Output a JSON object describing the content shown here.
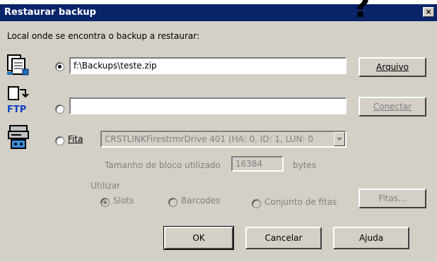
{
  "window": {
    "title": "Restaurar backup",
    "close_glyph": "×",
    "overlay_glyph": "?"
  },
  "location_label": "Local onde se encontra o backup a restaurar:",
  "sources": {
    "file": {
      "icon": "file-backup-icon",
      "selected": true,
      "value": "f:\\Backups\\teste.zip",
      "button": "Arquivo"
    },
    "ftp": {
      "icon": "ftp-icon",
      "selected": false,
      "value": "",
      "button": "Conectar"
    },
    "tape": {
      "icon": "tape-drive-icon",
      "selected": false,
      "label": "Fita",
      "drive": "CRSTLINKFirestrmrDrive  401 (HA: 0, ID: 1, LUN: 0",
      "block_label": "Tamanho de bloco utilizado",
      "block_value": "16384",
      "block_unit": "bytes",
      "use_label": "Utilizar",
      "options": {
        "slots": {
          "label": "Slots",
          "selected": true
        },
        "barcodes": {
          "label": "Barcodes",
          "selected": false
        },
        "set": {
          "label": "Conjunto de fitas",
          "selected": false
        }
      },
      "tapes_button": "Fitas..."
    }
  },
  "buttons": {
    "ok": "OK",
    "cancel": "Cancelar",
    "help": "Ajuda"
  }
}
